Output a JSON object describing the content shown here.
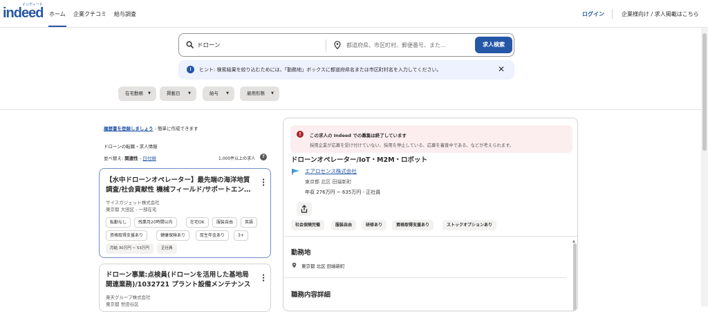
{
  "header": {
    "logo": "indeed",
    "logo_tagline": "インディード",
    "nav": [
      "ホーム",
      "企業クチコミ",
      "給与調査"
    ],
    "login": "ログイン",
    "employer_link": "企業様向け / 求人掲載はこちら"
  },
  "search": {
    "what_value": "ドローン",
    "where_placeholder": "都道府県、市区町村、郵便番号、また…",
    "button": "求人検索"
  },
  "hint": {
    "text": "ヒント: 検索結果を絞り込むためには、「勤務地」ボックスに都道府県名または市区町村名を入力してください。"
  },
  "filters": [
    "在宅勤務",
    "掲載日",
    "給与",
    "雇用形態"
  ],
  "left": {
    "resume_link": "履歴書を登録しましょう",
    "resume_suffix": " - 簡単に作成できます",
    "section_label": "ドローンの転職・求人情報",
    "sort_label": "並べ替え: ",
    "sort_active": "関連性",
    "sort_separator": " - ",
    "sort_other": "日付順",
    "result_count": "1,000件以上の求人",
    "help_icon": "?"
  },
  "jobs": [
    {
      "title": "【水中ドローンオペレーター】最先端の海洋地質調査/社会貢献性 機械フィールド/サポートエン…",
      "company": "サイスガジェット株式会社",
      "location": "東京都 大田区 - 一部在宅",
      "tags": [
        "転勤なし",
        "残業月20時間以内",
        "在宅OK",
        "服装自由",
        "英語",
        "資格取得支援あり",
        "健康保険あり",
        "厚生年金あり",
        "3+"
      ],
      "salary": "月給 30万円 ~ 53万円",
      "type": "正社員"
    },
    {
      "title": "ドローン事業:点検員(ドローンを活用した基地局関連業務)/1032721 プラント設備メンテナンス",
      "company": "楽天グループ株式会社",
      "location": "東京都 世田谷区"
    }
  ],
  "detail": {
    "expired_title": "この求人の Indeed での募集は終了しています",
    "expired_body": "採用企業が応募を受け付けていない、採用を停止している、応募を審査中である、などが考えられます。",
    "title": "ドローンオペレーター/IoT・M2M・ロボット",
    "company": "エアロセンス株式会社",
    "location": "東京都 北区 田端新町",
    "salary": "年収 276万円 ~ 635万円 - 正社員",
    "tags": [
      "社会保険完備",
      "服装自由",
      "研修あり",
      "資格取得支援あり",
      "ストックオプションあり"
    ],
    "work_location_heading": "勤務地",
    "work_location": "東京都 北区 田端新町",
    "job_detail_heading": "職務内容詳細"
  },
  "colors": {
    "brand": "#2557a7",
    "expired_bg": "#fceeef",
    "hint_bg": "#eef1fe"
  }
}
